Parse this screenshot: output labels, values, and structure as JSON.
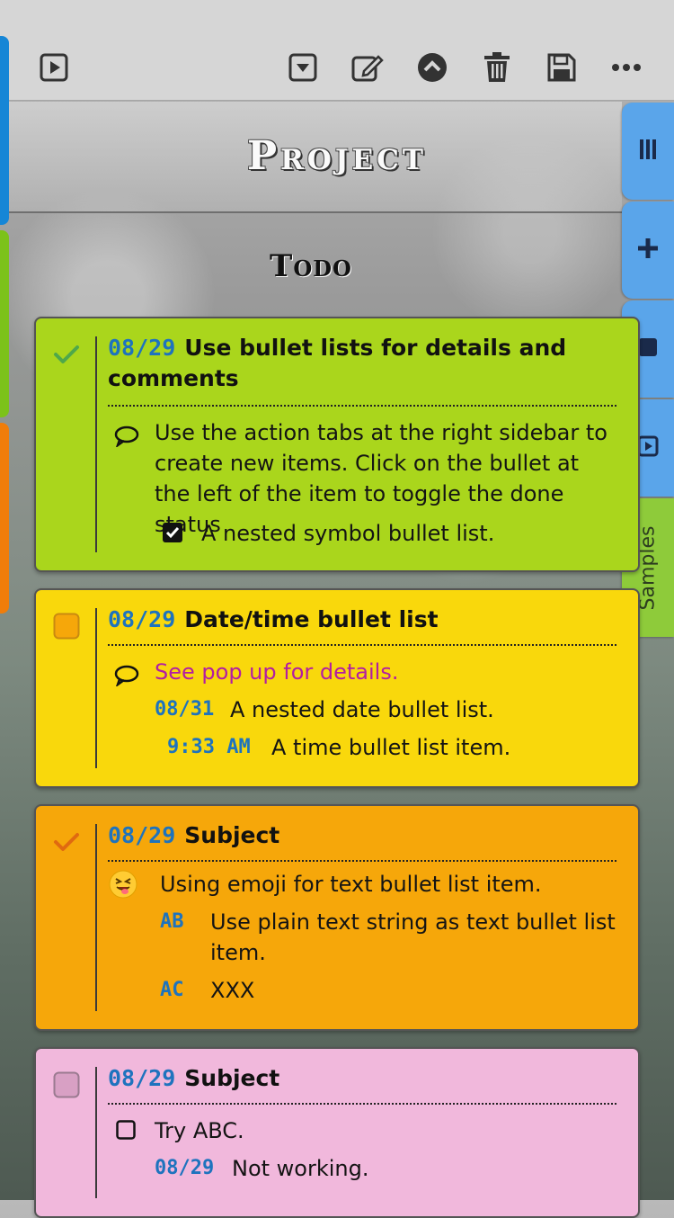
{
  "toolbar": {
    "icons": [
      "play-icon",
      "dropdown-icon",
      "edit-icon",
      "collapse-icon",
      "trash-icon",
      "save-icon",
      "more-icon"
    ]
  },
  "header": {
    "title": "Project",
    "subtitle": "Todo"
  },
  "sidebar": {
    "tabs": [
      {
        "icon": "columns-icon",
        "color": "#5aa5ea"
      },
      {
        "icon": "plus-icon",
        "color": "#5aa5ea"
      },
      {
        "icon": "stop-icon",
        "color": "#5aa5ea"
      },
      {
        "icon": "play-icon",
        "color": "#5aa5ea"
      },
      {
        "label": "Samples",
        "color": "#8ecb3a"
      }
    ]
  },
  "colors": {
    "green": "#aad61c",
    "yellow": "#f9d80c",
    "orange": "#f6a70a",
    "pink": "#f1b8dc",
    "date": "#1e73be",
    "link": "#b21ea3"
  },
  "cards": [
    {
      "status": "done",
      "date": "08/29",
      "subject": "Use bullet lists for details and comments",
      "comment": "Use the action tabs at the right sidebar to create new items. Click on the bullet at the left of the item to toggle the done status",
      "nested": "A nested symbol bullet list."
    },
    {
      "status": "open",
      "date": "08/29",
      "subject": "Date/time bullet list",
      "comment": "See pop up for details.",
      "nested_date": "08/31",
      "nested_date_text": "A nested date bullet list.",
      "time": "9:33 AM",
      "time_text": "A time bullet list item."
    },
    {
      "status": "done",
      "date": "08/29",
      "subject": "Subject",
      "emoji_text": "Using emoji for text bullet list item.",
      "ab_bullet": "AB",
      "ab_text": "Use plain text string as text bullet list item.",
      "ac_bullet": "AC",
      "ac_text": "XXX"
    },
    {
      "status": "open",
      "date": "08/29",
      "subject": "Subject",
      "checkbox_text": "Try ABC.",
      "nested_date": "08/29",
      "nested_date_text": "Not working."
    }
  ]
}
